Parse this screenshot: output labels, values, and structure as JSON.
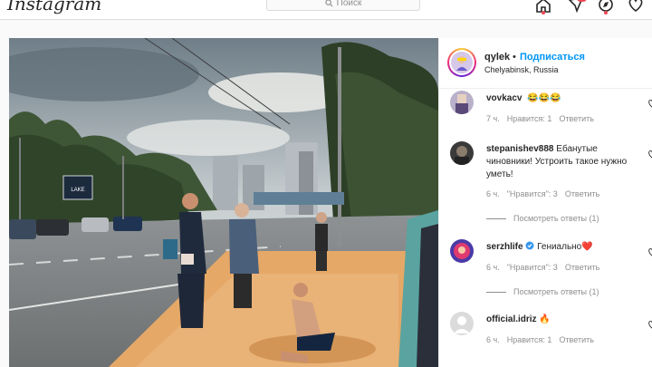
{
  "app": {
    "logo_text": "Instagram"
  },
  "search": {
    "placeholder": "Поиск"
  },
  "nav": {
    "icons": [
      "home-icon",
      "messenger-icon",
      "explore-icon",
      "heart-icon"
    ]
  },
  "post": {
    "username": "qylek",
    "separator": "•",
    "follow_label": "Подписаться",
    "location": "Chelyabinsk, Russia",
    "billboard_text": "LAKE"
  },
  "comments": [
    {
      "username": "vovkacv",
      "text": "😂😂😂",
      "time": "7 ч.",
      "likes": "Нравится: 1",
      "reply": "Ответить",
      "avatar_color": "#b9b0c9"
    },
    {
      "username": "stepanishev888",
      "text": "Ебанутые чиновники! Устроить такое нужно уметь!",
      "time": "6 ч.",
      "likes": "\"Нравится\": 3",
      "reply": "Ответить",
      "replies": "Посмотреть ответы (1)",
      "avatar_color": "#3a3a3a"
    },
    {
      "username": "serzhlife",
      "text": "Гениально❤️",
      "verified": true,
      "time": "6 ч.",
      "likes": "\"Нравится\": 3",
      "reply": "Ответить",
      "replies": "Посмотреть ответы (1)",
      "avatar_color": "#4a3aa8"
    },
    {
      "username": "official.idriz",
      "text": "🔥",
      "time": "6 ч.",
      "likes": "Нравится: 1",
      "reply": "Ответить",
      "avatar_color": "#dbdbdb"
    }
  ],
  "colors": {
    "link": "#0095f6",
    "muted": "#8e8e8e",
    "text": "#262626",
    "badge": "#ed4956"
  }
}
